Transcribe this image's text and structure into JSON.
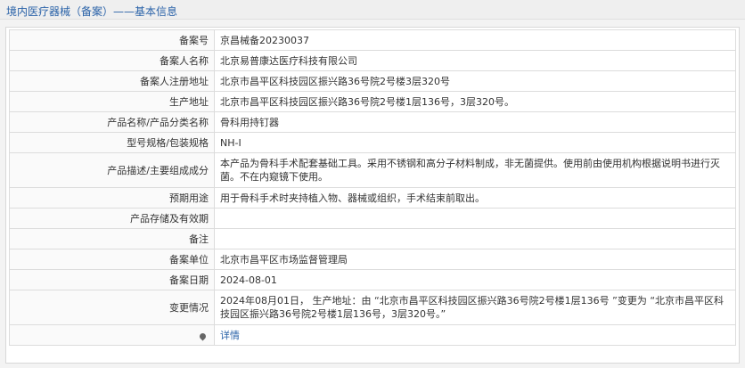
{
  "header": {
    "title": "境内医疗器械（备案）——基本信息"
  },
  "rows": [
    {
      "label": "备案号",
      "value": "京昌械备20230037"
    },
    {
      "label": "备案人名称",
      "value": "北京易普康达医疗科技有限公司"
    },
    {
      "label": "备案人注册地址",
      "value": "北京市昌平区科技园区振兴路36号院2号楼3层320号"
    },
    {
      "label": "生产地址",
      "value": "北京市昌平区科技园区振兴路36号院2号楼1层136号，3层320号。"
    },
    {
      "label": "产品名称/产品分类名称",
      "value": "骨科用持钉器"
    },
    {
      "label": "型号规格/包装规格",
      "value": "NH-Ⅰ"
    },
    {
      "label": "产品描述/主要组成成分",
      "value": "本产品为骨科手术配套基础工具。采用不锈钢和高分子材料制成，非无菌提供。使用前由使用机构根据说明书进行灭菌。不在内窥镜下使用。"
    },
    {
      "label": "预期用途",
      "value": "用于骨科手术时夹持植入物、器械或组织，手术结束前取出。"
    },
    {
      "label": "产品存储及有效期",
      "value": ""
    },
    {
      "label": "备注",
      "value": ""
    },
    {
      "label": "备案单位",
      "value": "北京市昌平区市场监督管理局"
    },
    {
      "label": "备案日期",
      "value": "2024-08-01"
    },
    {
      "label": "变更情况",
      "value": "2024年08月01日， 生产地址：由 “北京市昌平区科技园区振兴路36号院2号楼1层136号 ”变更为 “北京市昌平区科技园区振兴路36号院2号楼1层136号，3层320号。”"
    }
  ],
  "footer_row": {
    "link_text": "详情",
    "icon": "location-pin-icon"
  }
}
